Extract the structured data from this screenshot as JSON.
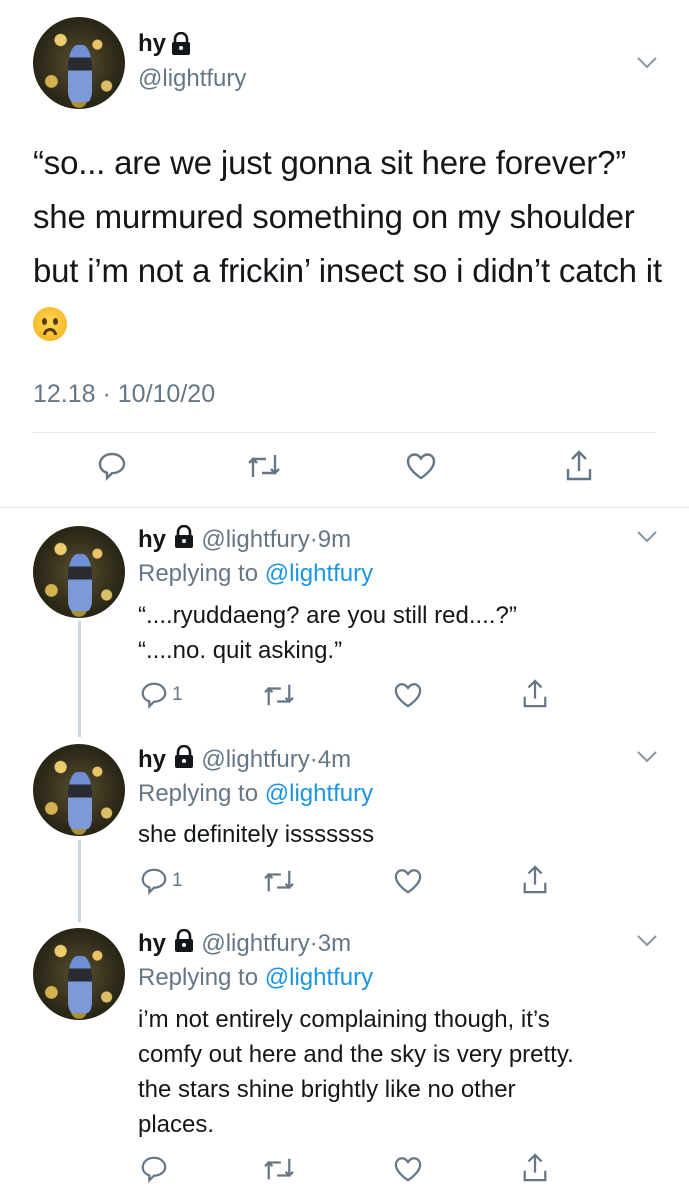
{
  "main_tweet": {
    "name": "hy",
    "handle": "@lightfury",
    "text": "“so... are we just gonna sit here forever?” she murmured something on my shoulder but i’m not a frickin’ insect so i didn’t catch it",
    "emoji": "worried-face",
    "timestamp": "12.18 · 10/10/20"
  },
  "replies": [
    {
      "name": "hy",
      "handle": "@lightfury",
      "dot": "·",
      "time": "9m",
      "replying_prefix": "Replying to ",
      "replying_to": "@lightfury",
      "lines": [
        "“....ryuddaeng? are you still red....?”",
        "“....no. quit asking.”"
      ],
      "reply_count": "1"
    },
    {
      "name": "hy",
      "handle": "@lightfury",
      "dot": "·",
      "time": "4m",
      "replying_prefix": "Replying to ",
      "replying_to": "@lightfury",
      "lines": [
        "she definitely isssssss"
      ],
      "reply_count": "1"
    },
    {
      "name": "hy",
      "handle": "@lightfury",
      "dot": "·",
      "time": "3m",
      "replying_prefix": "Replying to ",
      "replying_to": "@lightfury",
      "lines": [
        "i’m not entirely complaining though, it’s",
        "comfy out here and the sky is very pretty.",
        "the stars shine brightly like no other",
        "places."
      ],
      "reply_count": ""
    }
  ],
  "colors": {
    "text": "#14171a",
    "secondary": "#657786",
    "link": "#1b95e0",
    "divider": "#e1e8ed"
  },
  "icons": [
    "lock-icon",
    "chevron-down-icon",
    "reply-icon",
    "retweet-icon",
    "like-icon",
    "share-icon"
  ]
}
